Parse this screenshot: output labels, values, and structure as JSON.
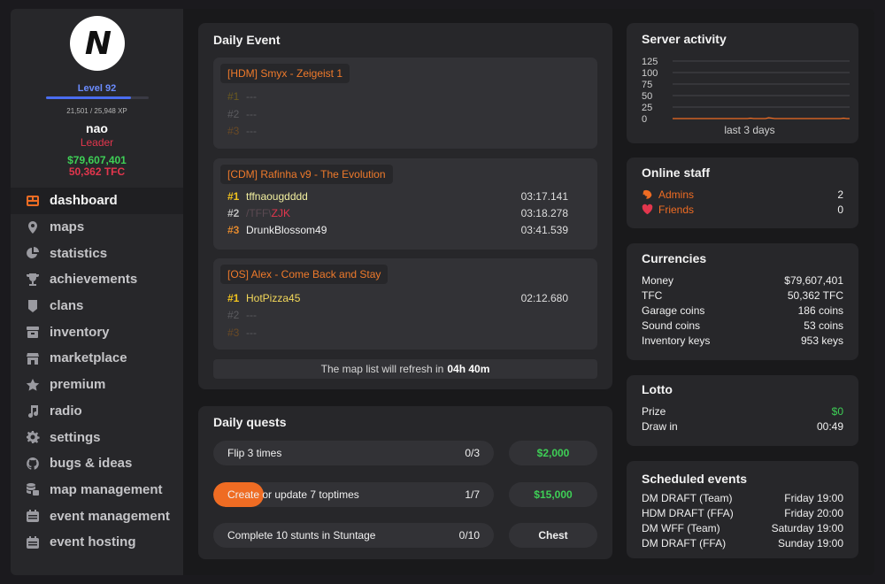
{
  "profile": {
    "avatar_letter": "N",
    "level": "Level 92",
    "xp_text": "21,501 / 25,948 XP",
    "xp_progress": 0.83,
    "name": "nao",
    "role": "Leader",
    "money": "$79,607,401",
    "tfc": "50,362 TFC"
  },
  "nav": [
    {
      "label": "dashboard",
      "icon": "dashboard-icon",
      "active": true
    },
    {
      "label": "maps",
      "icon": "map-pin-icon"
    },
    {
      "label": "statistics",
      "icon": "pie-chart-icon"
    },
    {
      "label": "achievements",
      "icon": "trophy-icon"
    },
    {
      "label": "clans",
      "icon": "shield-icon"
    },
    {
      "label": "inventory",
      "icon": "inventory-icon"
    },
    {
      "label": "marketplace",
      "icon": "store-icon"
    },
    {
      "label": "premium",
      "icon": "star-icon"
    },
    {
      "label": "radio",
      "icon": "music-note-icon"
    },
    {
      "label": "settings",
      "icon": "gear-icon"
    },
    {
      "label": "bugs & ideas",
      "icon": "github-icon"
    },
    {
      "label": "map management",
      "icon": "map-database-icon"
    },
    {
      "label": "event management",
      "icon": "calendar-icon"
    },
    {
      "label": "event hosting",
      "icon": "calendar-icon"
    }
  ],
  "daily_event": {
    "title": "Daily Event",
    "events": [
      {
        "name": "[HDM] Smyx - Zeigeist 1",
        "ranks": [
          {
            "rank": "#1",
            "player": "---",
            "time": ""
          },
          {
            "rank": "#2",
            "player": "---",
            "time": ""
          },
          {
            "rank": "#3",
            "player": "---",
            "time": ""
          }
        ]
      },
      {
        "name": "[CDM] Rafinha v9 - The Evolution",
        "ranks": [
          {
            "rank": "#1",
            "player": "tffnaougdddd",
            "time": "03:17.141"
          },
          {
            "rank": "#2",
            "player_prefix": "/TFF\\",
            "player_suffix": "ZJK",
            "time": "03:18.278"
          },
          {
            "rank": "#3",
            "player": "DrunkBlossom49",
            "time": "03:41.539"
          }
        ]
      },
      {
        "name": "[OS] Alex - Come Back and Stay",
        "ranks": [
          {
            "rank": "#1",
            "player": "HotPizza45",
            "time": "02:12.680"
          },
          {
            "rank": "#2",
            "player": "---",
            "time": ""
          },
          {
            "rank": "#3",
            "player": "---",
            "time": ""
          }
        ]
      }
    ],
    "refresh_text": "The map list will refresh in",
    "refresh_time": "04h 40m"
  },
  "daily_quests": {
    "title": "Daily quests",
    "quests": [
      {
        "label": "Flip 3 times",
        "progress": "0/3",
        "fraction": 0.0,
        "reward": "$2,000"
      },
      {
        "label": "Create or update 7 toptimes",
        "progress": "1/7",
        "fraction": 0.143,
        "reward": "$15,000"
      },
      {
        "label": "Complete 10 stunts in Stuntage",
        "progress": "0/10",
        "fraction": 0.0,
        "reward": "Chest"
      }
    ]
  },
  "server_activity": {
    "title": "Server activity",
    "caption": "last 3 days"
  },
  "chart_data": {
    "type": "line",
    "yticks": [
      125,
      100,
      75,
      50,
      25,
      0
    ],
    "ylim": [
      0,
      125
    ],
    "xlabel": "last 3 days",
    "series": [
      {
        "values": [
          0,
          0,
          0,
          0,
          0,
          0,
          0,
          0,
          0,
          0,
          0,
          0,
          0,
          0,
          0,
          0,
          0,
          0,
          0,
          0,
          0,
          0,
          0,
          0,
          0,
          0,
          1,
          0,
          0,
          0,
          0,
          0,
          2,
          1,
          0,
          0,
          0,
          0,
          0,
          0,
          0,
          0,
          0,
          0,
          0,
          0,
          0,
          0,
          0,
          0,
          0,
          0,
          0,
          0,
          0,
          0,
          0,
          1,
          0,
          0
        ]
      }
    ]
  },
  "online_staff": {
    "title": "Online staff",
    "rows": [
      {
        "label": "Admins",
        "icon": "shrimp-icon",
        "value": "2"
      },
      {
        "label": "Friends",
        "icon": "heart-icon",
        "value": "0"
      }
    ]
  },
  "currencies": {
    "title": "Currencies",
    "rows": [
      {
        "label": "Money",
        "value": "$79,607,401"
      },
      {
        "label": "TFC",
        "value": "50,362 TFC"
      },
      {
        "label": "Garage coins",
        "value": "186 coins"
      },
      {
        "label": "Sound coins",
        "value": "53 coins"
      },
      {
        "label": "Inventory keys",
        "value": "953 keys"
      }
    ]
  },
  "lotto": {
    "title": "Lotto",
    "rows": [
      {
        "label": "Prize",
        "value": "$0"
      },
      {
        "label": "Draw in",
        "value": "00:49"
      }
    ]
  },
  "scheduled_events": {
    "title": "Scheduled events",
    "rows": [
      {
        "label": "DM DRAFT (Team)",
        "value": "Friday 19:00"
      },
      {
        "label": "HDM DRAFT (FFA)",
        "value": "Friday 20:00"
      },
      {
        "label": "DM WFF (Team)",
        "value": "Saturday 19:00"
      },
      {
        "label": "DM DRAFT (FFA)",
        "value": "Sunday 19:00"
      }
    ]
  },
  "colors": {
    "accent": "#ef6c23",
    "money_green": "#3ecf56",
    "leader_red": "#e2364d",
    "level_blue": "#6b8cff"
  }
}
